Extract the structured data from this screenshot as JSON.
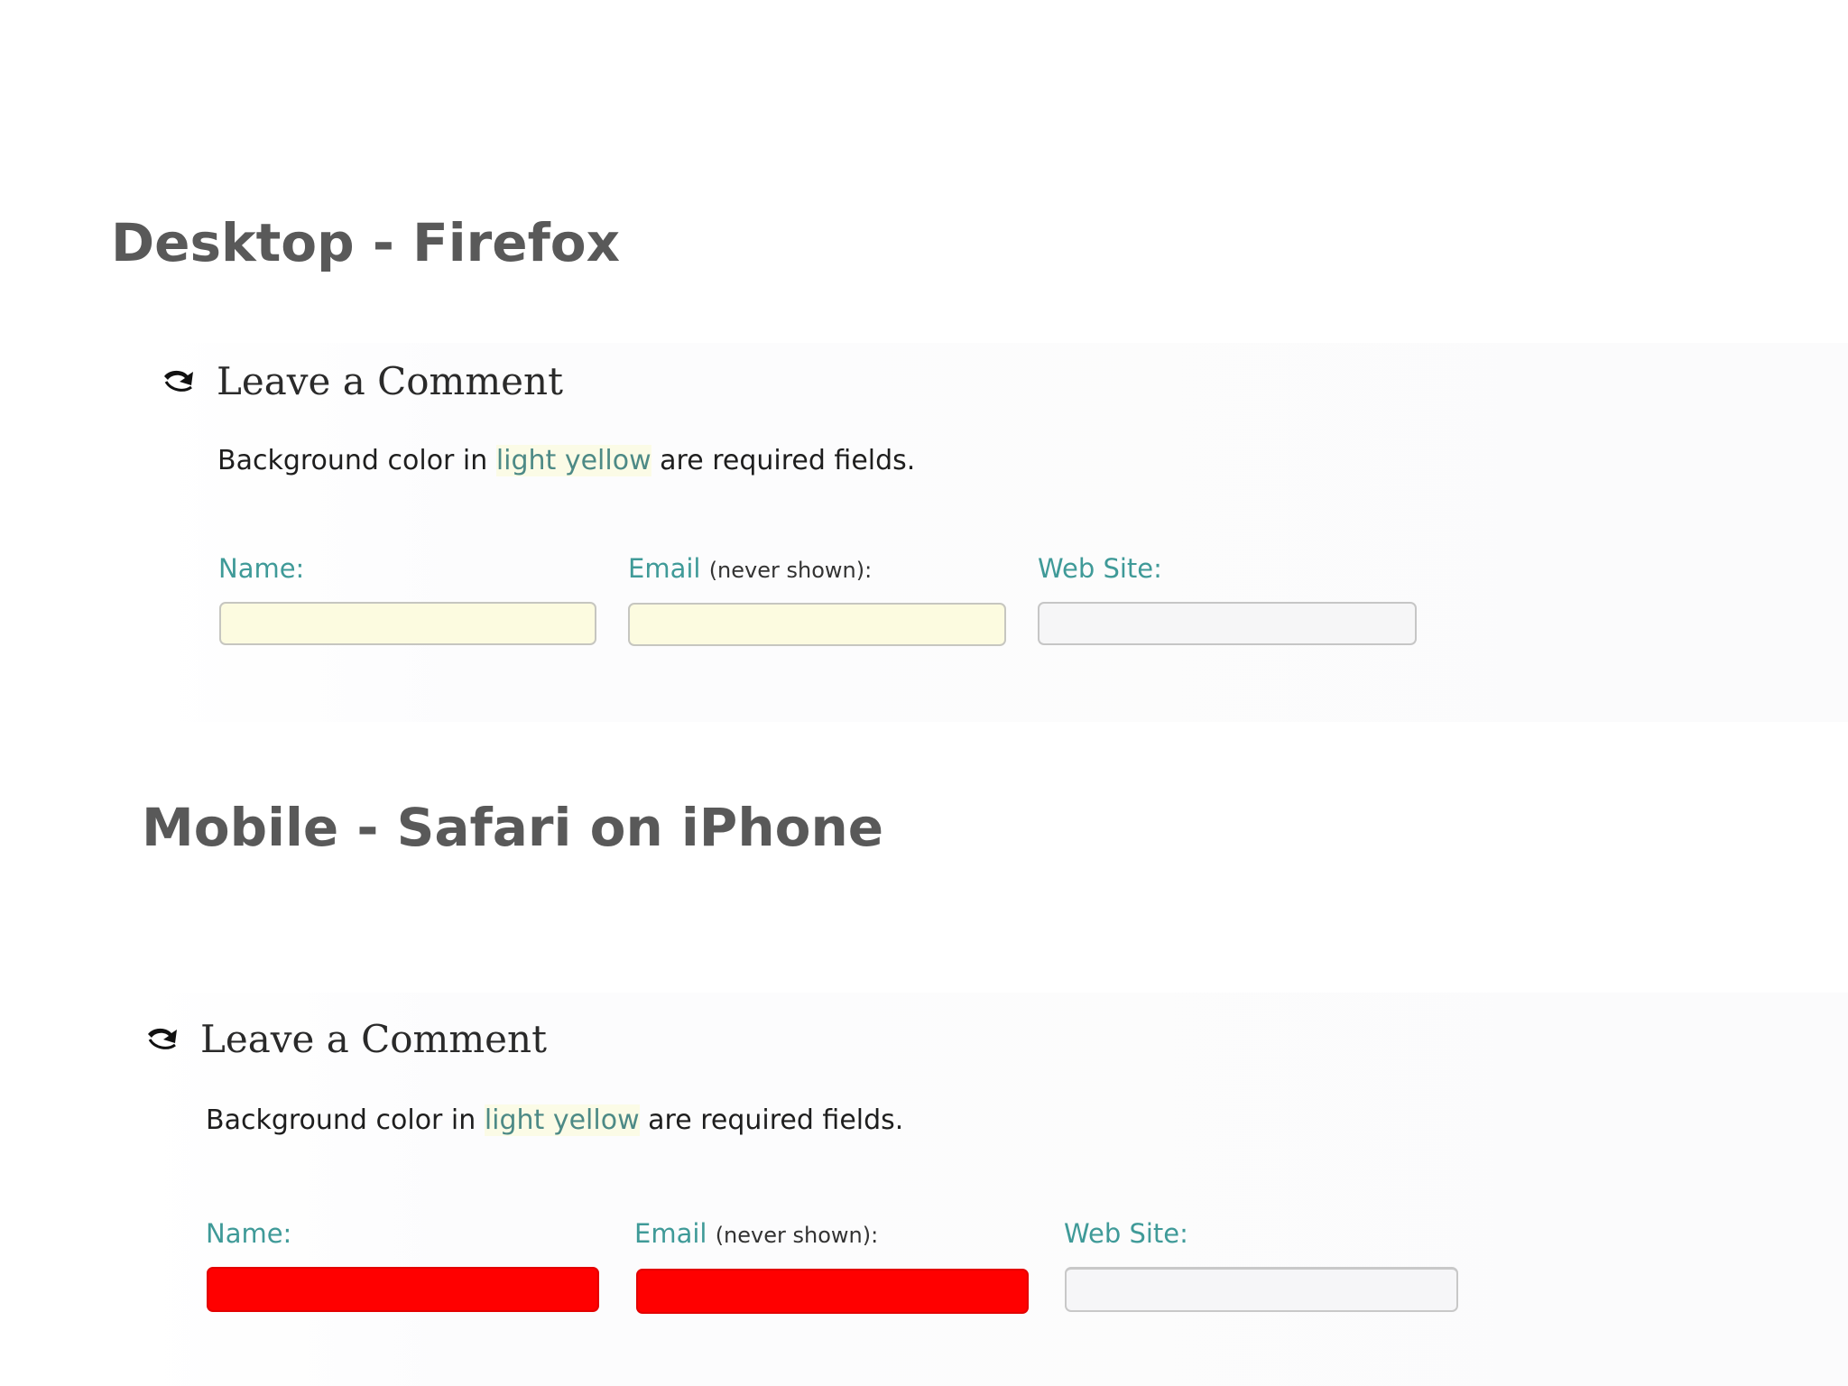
{
  "sections": {
    "desktop": {
      "title": "Desktop - Firefox",
      "heading": "Leave a Comment",
      "icon": "reply-arrow-icon",
      "instructions_before": "Background color in ",
      "instructions_highlight": "light yellow",
      "instructions_after": " are required fields.",
      "fields": {
        "name_label": "Name:",
        "email_label": "Email",
        "email_note": "(never shown):",
        "website_label": "Web Site:",
        "name_value": "",
        "email_value": "",
        "website_value": ""
      },
      "colors": {
        "required_bg": "#fcfbe0",
        "optional_bg": "#f6f6f7",
        "label_color": "#3f9a98"
      }
    },
    "mobile": {
      "title": "Mobile - Safari on iPhone",
      "heading": "Leave a Comment",
      "icon": "reply-arrow-icon",
      "instructions_before": "Background color in ",
      "instructions_highlight": "light yellow",
      "instructions_after": " are required fields.",
      "fields": {
        "name_label": "Name:",
        "email_label": "Email",
        "email_note": "(never shown):",
        "website_label": "Web Site:",
        "name_value": "",
        "email_value": "",
        "website_value": ""
      },
      "colors": {
        "required_bg": "#ff0000",
        "optional_bg": "#f6f6f8",
        "label_color": "#3f9a98"
      }
    }
  }
}
